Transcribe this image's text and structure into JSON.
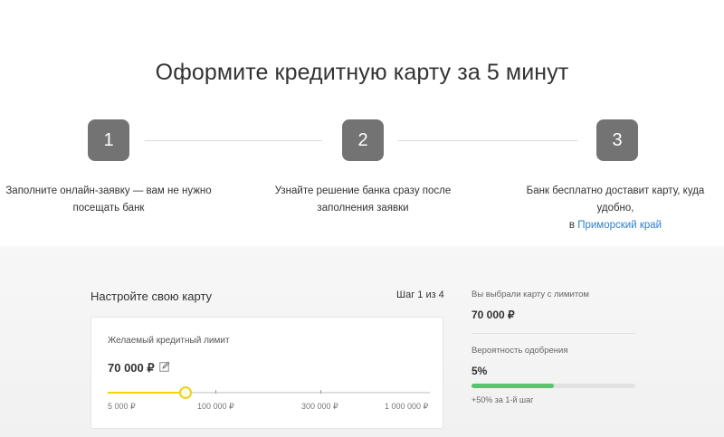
{
  "page_title": "Оформите кредитную карту за 5 минут",
  "steps": [
    {
      "number": "1",
      "text_line1": "Заполните онлайн-заявку — вам не нужно",
      "text_line2": "посещать банк"
    },
    {
      "number": "2",
      "text_line1": "Узнайте решение банка сразу после",
      "text_line2": "заполнения заявки"
    },
    {
      "number": "3",
      "text_line1": "Банк бесплатно доставит карту, куда удобно,",
      "text_line2_prefix": "в",
      "text_line2_link": "Приморский край"
    }
  ],
  "configurator": {
    "title": "Настройте свою карту",
    "step_counter": "Шаг 1 из 4",
    "limit_label": "Желаемый кредитный лимит",
    "limit_value": "70 000 ₽",
    "slider": {
      "ticks": [
        "5 000 ₽",
        "100 000 ₽",
        "300 000 ₽",
        "1 000 000 ₽"
      ],
      "value_fraction": 0.24
    }
  },
  "summary": {
    "selected_label": "Вы выбрали карту с лимитом",
    "selected_value": "70 000 ₽",
    "approval_label": "Вероятность одобрения",
    "approval_value": "5%",
    "approval_fraction": 0.5,
    "approval_note": "+50% за 1-й шаг"
  },
  "colors": {
    "step_badge": "#737373",
    "link": "#2d7fd3",
    "slider_accent": "#f5d400",
    "progress": "#58c46c"
  },
  "icons": {
    "edit": "pencil-edit-icon"
  }
}
